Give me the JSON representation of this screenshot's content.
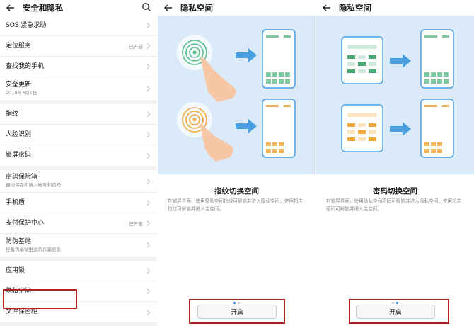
{
  "settings": {
    "title": "安全和隐私",
    "items": [
      {
        "label": "SOS 紧急求助"
      },
      {
        "label": "定位服务",
        "value": "已开启"
      },
      {
        "label": "查找我的手机"
      },
      {
        "label": "安全更新",
        "sub": "2019年3月1日"
      },
      {
        "label": "指纹"
      },
      {
        "label": "人脸识别"
      },
      {
        "label": "锁屏密码"
      },
      {
        "label": "密码保险箱",
        "sub": "自动保存和填入帐号和密码"
      },
      {
        "label": "手机盾"
      },
      {
        "label": "支付保护中心",
        "value": "已开启"
      },
      {
        "label": "防伪基站",
        "sub": "拦截伪基站推送的诈骗信息"
      },
      {
        "label": "应用锁"
      },
      {
        "label": "隐私空间"
      },
      {
        "label": "文件保密柜"
      }
    ]
  },
  "fingerprint_page": {
    "title": "隐私空间",
    "heading": "指纹切换空间",
    "description": "在锁屏界面，使用隐私空间指纹可解锁并进入隐私空间，使用机主指纹可解锁并进入主空间。",
    "button": "开启",
    "page_index": 1,
    "page_count": 2
  },
  "password_page": {
    "title": "隐私空间",
    "heading": "密码切换空间",
    "description": "在锁屏界面，使用隐私空间密码可解锁并进入隐私空间，使用机主密码可解锁并进入主空间。",
    "button": "开启",
    "page_index": 2,
    "page_count": 2
  },
  "colors": {
    "highlight": "#b51f1f",
    "illustration_bg": "#dbeaf8",
    "green_tile": "#7ec79f",
    "orange_tile": "#f2b65a",
    "arrow": "#4a9fe0",
    "page_dot_active": "#1f7ce8"
  }
}
